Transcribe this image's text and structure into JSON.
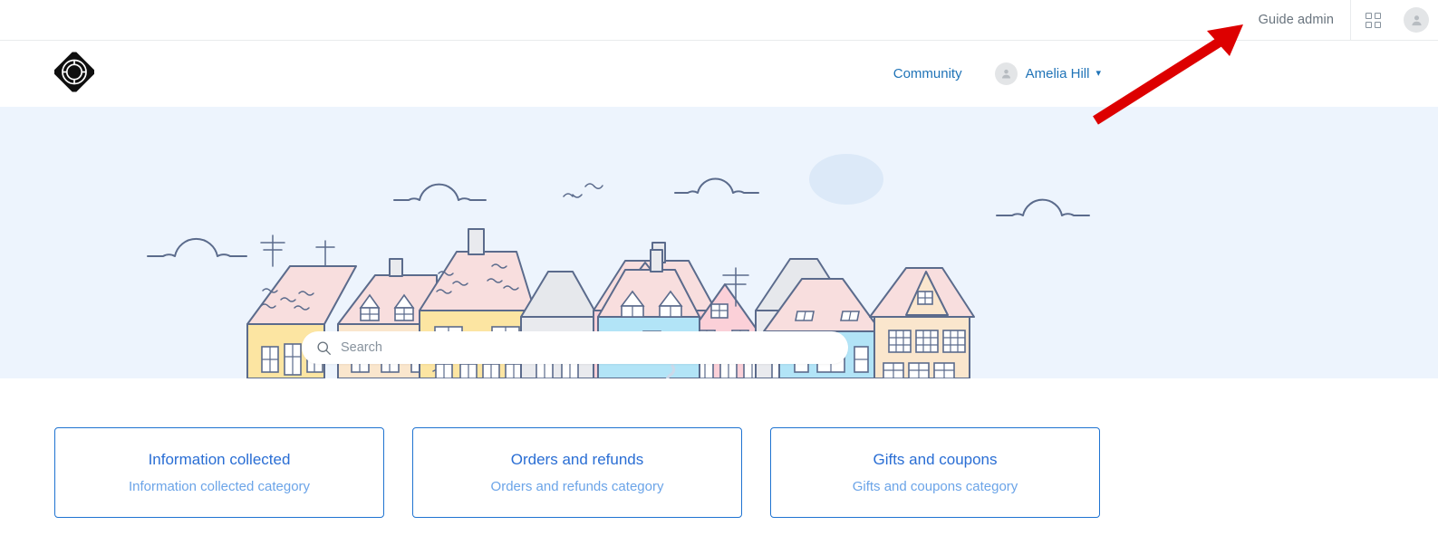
{
  "topbar": {
    "guide_admin_label": "Guide admin",
    "products_icon": "grid-apps-icon",
    "account_icon": "user-avatar-icon"
  },
  "header": {
    "logo_icon": "lifebuoy-diamond-logo",
    "nav": [
      {
        "label": "Community",
        "name": "nav-link-community"
      }
    ],
    "user": {
      "name": "Amelia Hill",
      "avatar_icon": "user-avatar-icon",
      "caret_icon": "chevron-down-icon"
    }
  },
  "hero": {
    "background_color": "#edf4fd",
    "illustration": "town-houses-skyline-illustration",
    "search": {
      "placeholder": "Search",
      "value": "",
      "icon": "search-icon"
    }
  },
  "categories": [
    {
      "title": "Information collected",
      "description": "Information collected category",
      "name": "category-card-information-collected"
    },
    {
      "title": "Orders and refunds",
      "description": "Orders and refunds category",
      "name": "category-card-orders-and-refunds"
    },
    {
      "title": "Gifts and coupons",
      "description": "Gifts and coupons category",
      "name": "category-card-gifts-and-coupons"
    }
  ],
  "annotation": {
    "arrow_color": "#dd0000",
    "points_to": "Guide admin"
  },
  "colors": {
    "link_blue": "#1f73b7",
    "card_border": "#1f73d1",
    "card_title": "#2a6ed4",
    "card_sub": "#6ba4e8",
    "hero_bg": "#edf4fd",
    "muted_text": "#68737d"
  }
}
